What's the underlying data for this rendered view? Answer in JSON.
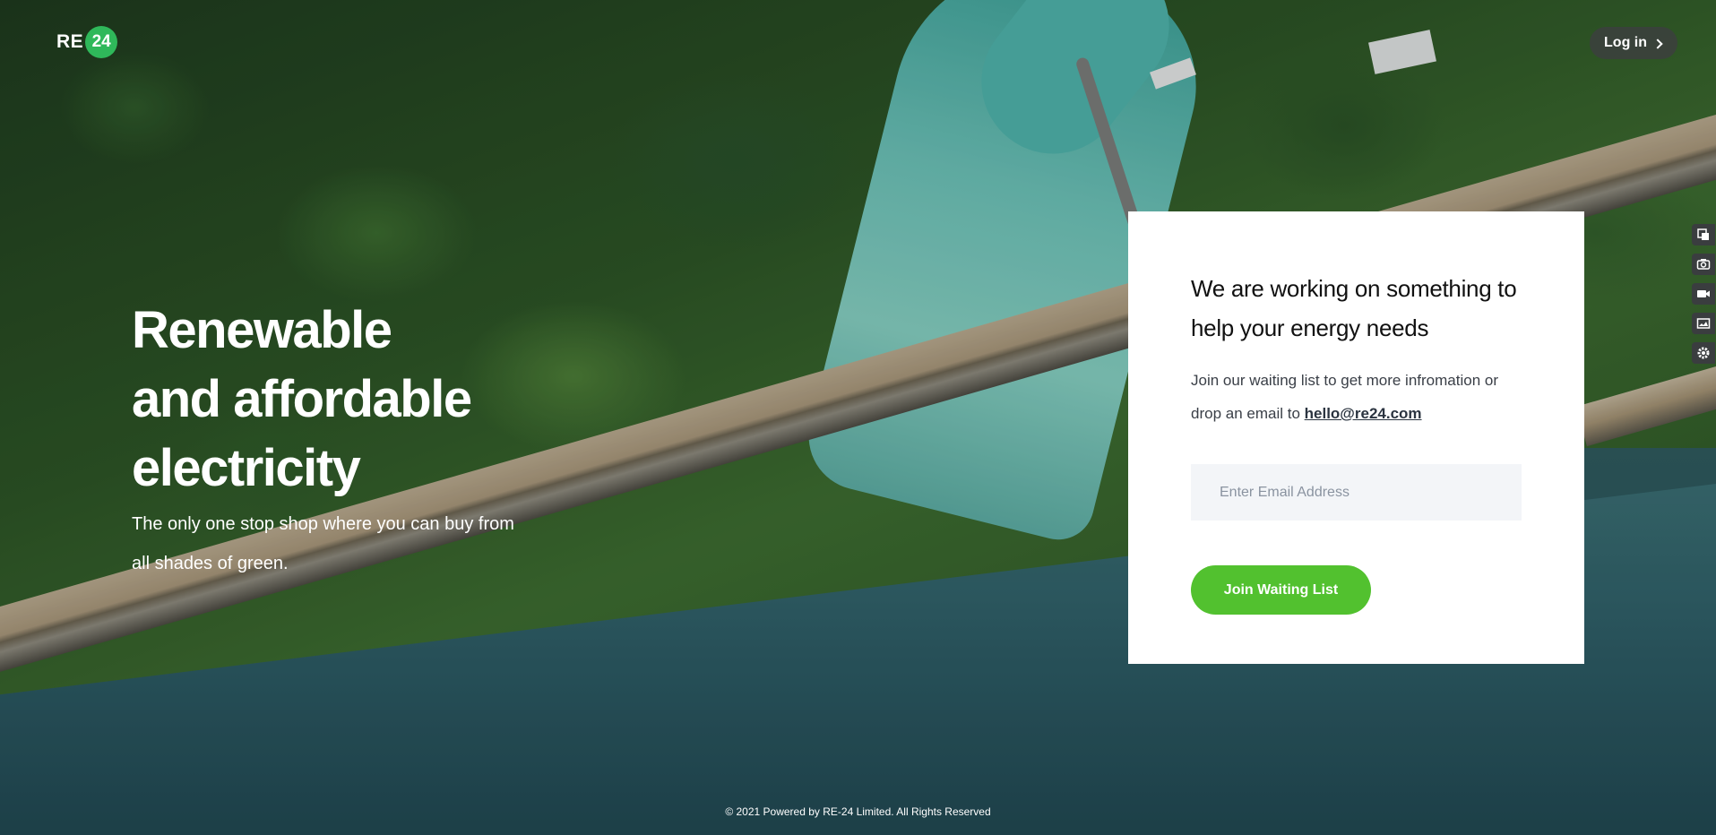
{
  "brand": {
    "logo_text": "RE",
    "logo_badge": "24",
    "accent": "#2fb85a"
  },
  "header": {
    "login_label": "Log in",
    "login_icon": "chevron-right-icon"
  },
  "hero": {
    "title_line1": "Renewable",
    "title_line2": "and affordable",
    "title_line3": "electricity",
    "subtitle": "The only one stop shop where you can buy from all shades of green."
  },
  "card": {
    "title": "We are working on something to help your energy needs",
    "text_before_link": "Join our waiting list to get more infromation or drop an email to ",
    "email_link": "hello@re24.com",
    "email_placeholder": "Enter Email Address",
    "button_label": "Join Waiting List",
    "button_color": "#52c12f"
  },
  "footer": {
    "text": "© 2021 Powered by RE-24 Limited. All Rights Reserved"
  },
  "side_tools": [
    "screenshot-icon",
    "camera-icon",
    "video-icon",
    "gallery-icon",
    "settings-icon"
  ]
}
